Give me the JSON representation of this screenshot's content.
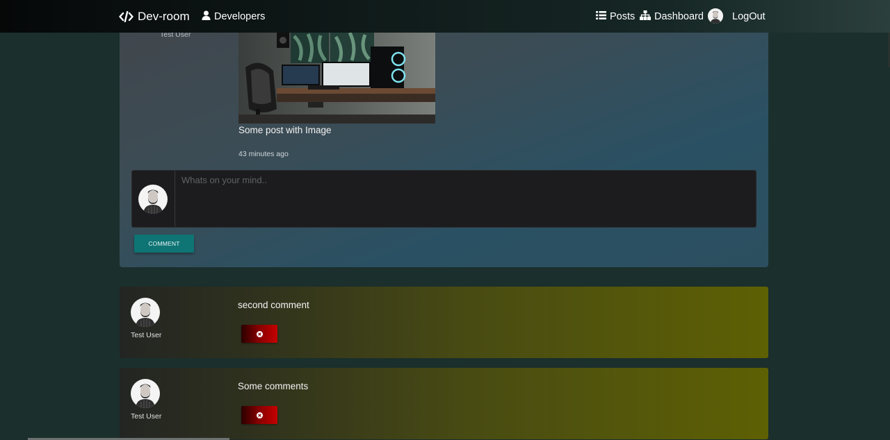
{
  "nav": {
    "brand": "Dev-room",
    "developers": "Developers",
    "posts": "Posts",
    "dashboard": "Dashboard",
    "logout": "LogOut",
    "icons": [
      "code-icon",
      "user-icon",
      "list-icon",
      "sitemap-icon",
      "avatar"
    ]
  },
  "post": {
    "author": "Test User",
    "text": "Some post with Image",
    "time": "43 minutes ago"
  },
  "comment_form": {
    "placeholder": "Whats on your mind..",
    "button": "COMMENT"
  },
  "comments": [
    {
      "user": "Test User",
      "text": "second comment"
    },
    {
      "user": "Test User",
      "text": "Some comments"
    }
  ],
  "colors": {
    "accent": "#0f7474",
    "delete": "#c40000",
    "comment_card": "#5e6004",
    "background": "#1b2f2c"
  }
}
